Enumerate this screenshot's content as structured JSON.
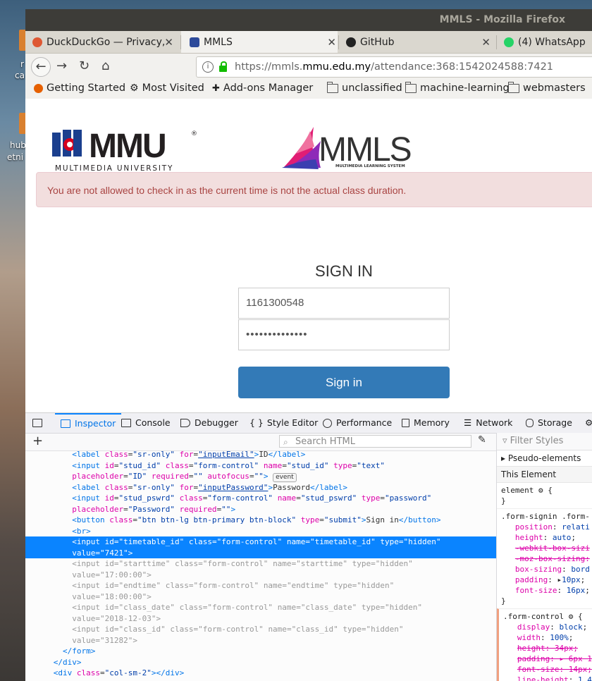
{
  "desktop": {
    "labels": [
      "r",
      "ca",
      "hub",
      "etni"
    ]
  },
  "window": {
    "title": "MMLS - Mozilla Firefox"
  },
  "tabs": [
    {
      "label": "DuckDuckGo — Privacy,",
      "close": "✕"
    },
    {
      "label": "MMLS",
      "close": "✕"
    },
    {
      "label": "GitHub",
      "close": "✕"
    },
    {
      "label": "(4) WhatsApp"
    }
  ],
  "url": {
    "prefix": "https://mmls.",
    "domain": "mmu.edu.my",
    "path": "/attendance:368:1542024588:7421"
  },
  "bookmarks": [
    "Getting Started",
    "Most Visited",
    "Add-ons Manager",
    "unclassified",
    "machine-learning",
    "webmasters"
  ],
  "page": {
    "mmu_logo": "MMU",
    "mmu_sub": "MULTIMEDIA UNIVERSITY",
    "mmls_logo": "MMLS",
    "mmls_sub": "MULTIMEDIA LEARNING SYSTEM",
    "alert": "You are not allowed to check in as the current time is not the actual class duration.",
    "heading": "SIGN IN",
    "id_value": "1161300548",
    "password_value": "••••••••••••••",
    "signin_button": "Sign in"
  },
  "devtools": {
    "tabs": [
      "Inspector",
      "Console",
      "Debugger",
      "Style Editor",
      "Performance",
      "Memory",
      "Network",
      "Storage"
    ],
    "search_placeholder": "Search HTML",
    "filter_placeholder": "Filter Styles",
    "pseudo": "Pseudo-elements",
    "this_element": "This Element",
    "event_badge": "event"
  }
}
